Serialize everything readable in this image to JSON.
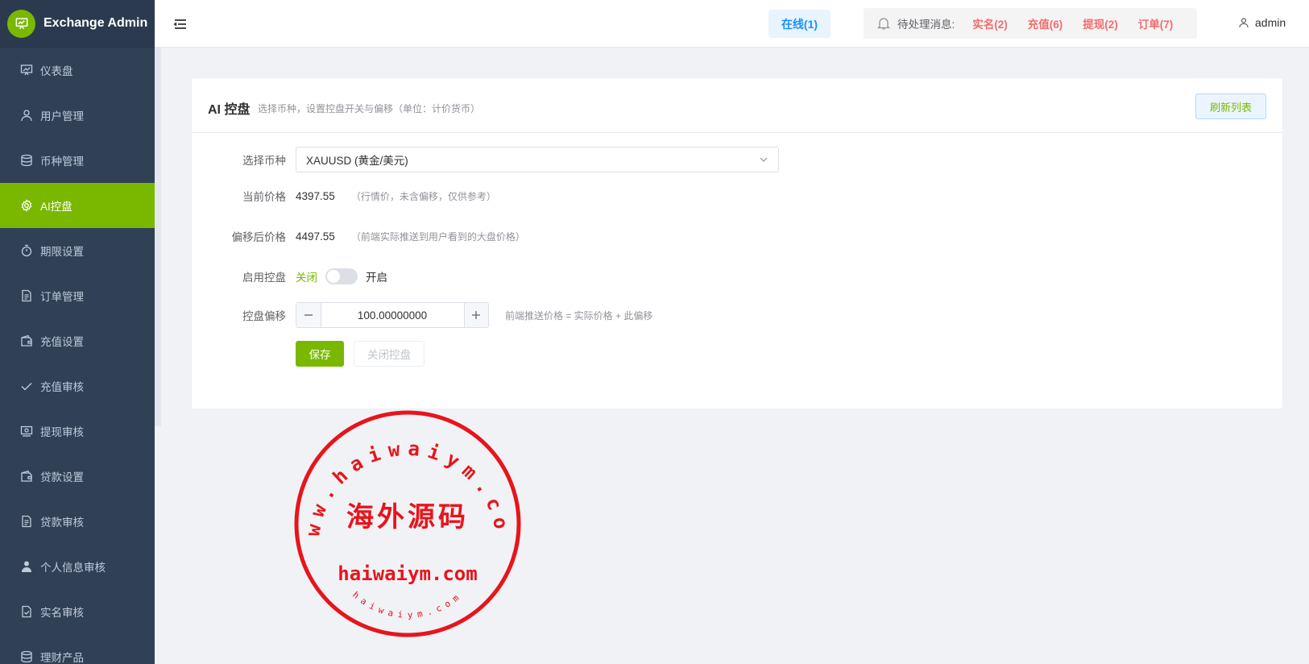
{
  "app": {
    "title": "Exchange Admin",
    "brand_color": "#7ab800"
  },
  "sidebar": {
    "items": [
      {
        "label": "仪表盘",
        "icon": "chart-icon"
      },
      {
        "label": "用户管理",
        "icon": "user-icon"
      },
      {
        "label": "币种管理",
        "icon": "database-icon"
      },
      {
        "label": "AI控盘",
        "icon": "gear-icon",
        "active": true
      },
      {
        "label": "期限设置",
        "icon": "stopwatch-icon"
      },
      {
        "label": "订单管理",
        "icon": "document-icon"
      },
      {
        "label": "充值设置",
        "icon": "wallet-icon"
      },
      {
        "label": "充值审核",
        "icon": "check-icon"
      },
      {
        "label": "提现审核",
        "icon": "money-icon"
      },
      {
        "label": "贷款设置",
        "icon": "wallet-icon"
      },
      {
        "label": "贷款审核",
        "icon": "document-icon"
      },
      {
        "label": "个人信息审核",
        "icon": "person-icon"
      },
      {
        "label": "实名审核",
        "icon": "document-check-icon"
      },
      {
        "label": "理财产品",
        "icon": "database-icon"
      }
    ]
  },
  "header": {
    "online": "在线(1)",
    "notice_label": "待处理消息:",
    "notices": [
      {
        "label": "实名(2)"
      },
      {
        "label": "充值(6)"
      },
      {
        "label": "提现(2)"
      },
      {
        "label": "订单(7)"
      }
    ],
    "user": "admin"
  },
  "card": {
    "title": "AI 控盘",
    "subtitle": "选择币种，设置控盘开关与偏移（单位：计价货币）",
    "refresh_label": "刷新列表"
  },
  "form": {
    "coin_label": "选择币种",
    "coin_value": "XAUUSD (黄金/美元)",
    "current_price_label": "当前价格",
    "current_price": "4397.55",
    "current_price_hint": "（行情价，未含偏移，仅供参考）",
    "offset_price_label": "偏移后价格",
    "offset_price": "4497.55",
    "offset_price_hint": "（前端实际推送到用户看到的大盘价格）",
    "enable_label": "启用控盘",
    "switch_off": "关闭",
    "switch_on": "开启",
    "switch_enabled": false,
    "offset_label": "控盘偏移",
    "offset_value": "100.00000000",
    "offset_hint": "前端推送价格 = 实际价格 + 此偏移",
    "save_label": "保存",
    "close_label": "关闭控盘"
  },
  "watermark": {
    "center_text": "海外源码",
    "line_text": "haiwaiym.com",
    "ring_text": "www.haiwaiym.com",
    "inner_ring_text": "haiwaiym.com",
    "color": "#e8141c"
  }
}
